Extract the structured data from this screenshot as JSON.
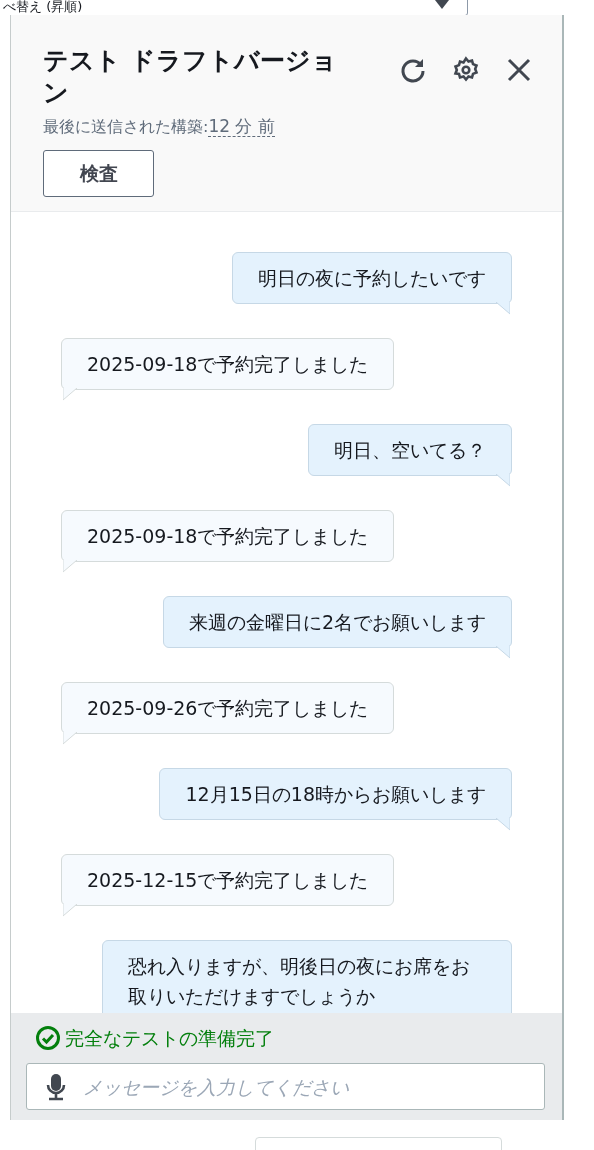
{
  "background": {
    "sort_label": "べ替え (昇順)"
  },
  "panel": {
    "title": "テスト ドラフトバージョン",
    "subtitle": "最後に送信された構築:",
    "time": "12 分 前",
    "inspect_button": "検査"
  },
  "messages": [
    {
      "kind": "user",
      "text": "明日の夜に予約したいです"
    },
    {
      "kind": "bot",
      "text": "2025-09-18で予約完了しました"
    },
    {
      "kind": "user",
      "text": "明日、空いてる？"
    },
    {
      "kind": "bot",
      "text": "2025-09-18で予約完了しました"
    },
    {
      "kind": "user",
      "text": "来週の金曜日に2名でお願いします"
    },
    {
      "kind": "bot",
      "text": "2025-09-26で予約完了しました"
    },
    {
      "kind": "user",
      "text": "12月15日の18時からお願いします"
    },
    {
      "kind": "bot",
      "text": "2025-12-15で予約完了しました"
    },
    {
      "kind": "user",
      "text": "恐れ入りますが、明後日の夜にお席をお取りいただけますでしょうか"
    }
  ],
  "status": {
    "text": "完全なテストの準備完了"
  },
  "input": {
    "placeholder": "メッセージを入力してください"
  }
}
